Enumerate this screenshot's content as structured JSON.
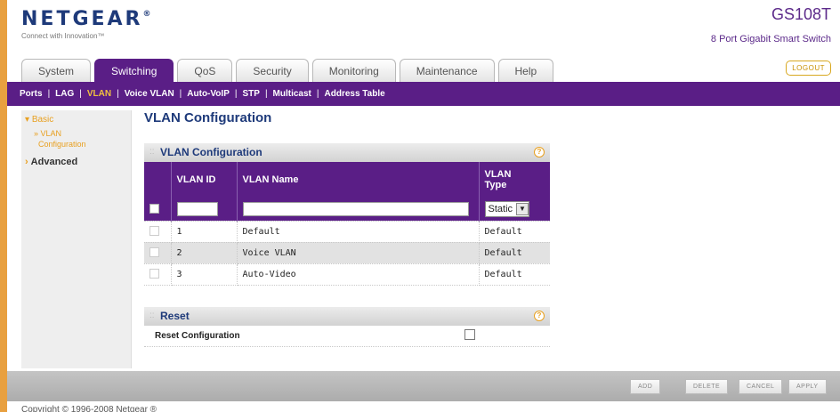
{
  "header": {
    "logo": "NETGEAR",
    "logo_mark": "®",
    "tagline": "Connect with Innovation™",
    "model": "GS108T",
    "model_desc": "8 Port Gigabit Smart Switch",
    "logout_label": "LOGOUT"
  },
  "tabs": [
    {
      "label": "System"
    },
    {
      "label": "Switching"
    },
    {
      "label": "QoS"
    },
    {
      "label": "Security"
    },
    {
      "label": "Monitoring"
    },
    {
      "label": "Maintenance"
    },
    {
      "label": "Help"
    }
  ],
  "active_tab": "Switching",
  "subnav": [
    {
      "label": "Ports"
    },
    {
      "label": "LAG"
    },
    {
      "label": "VLAN"
    },
    {
      "label": "Voice VLAN"
    },
    {
      "label": "Auto-VoIP"
    },
    {
      "label": "STP"
    },
    {
      "label": "Multicast"
    },
    {
      "label": "Address Table"
    }
  ],
  "active_subnav": "VLAN",
  "leftnav": {
    "basic": "Basic",
    "vlan_config_line1": "» VLAN",
    "vlan_config_line2": "Configuration",
    "advanced": "Advanced"
  },
  "page_title": "VLAN Configuration",
  "vlan_panel": {
    "title": "VLAN Configuration",
    "columns": {
      "vlan_id": "VLAN ID",
      "vlan_name": "VLAN Name",
      "vlan_type_1": "VLAN",
      "vlan_type_2": "Type"
    },
    "new_row_type": "Static",
    "rows": [
      {
        "id": "1",
        "name": "Default",
        "type": "Default"
      },
      {
        "id": "2",
        "name": "Voice VLAN",
        "type": "Default"
      },
      {
        "id": "3",
        "name": "Auto-Video",
        "type": "Default"
      }
    ]
  },
  "reset_panel": {
    "title": "Reset",
    "label": "Reset Configuration"
  },
  "footer": {
    "add": "ADD",
    "delete": "DELETE",
    "cancel": "CANCEL",
    "apply": "APPLY",
    "copyright": "Copyright © 1996-2008 Netgear ®"
  }
}
